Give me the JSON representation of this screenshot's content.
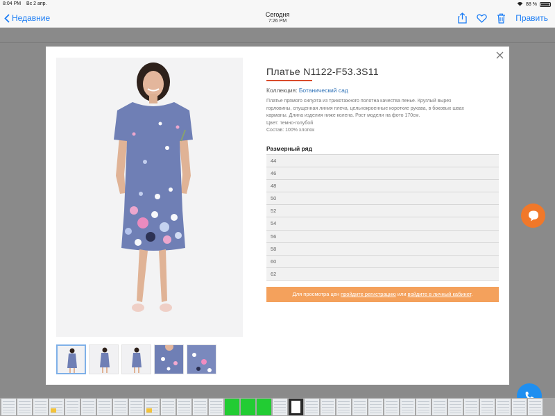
{
  "status_bar": {
    "time": "8:04 PM",
    "date": "Вс 2 апр.",
    "battery": "88 %"
  },
  "nav": {
    "back_label": "Недавние",
    "title": "Сегодня",
    "subtitle": "7:26 PM",
    "edit_label": "Править"
  },
  "product": {
    "title": "Платье N1122-F53.3S11",
    "collection_label": "Коллекция:",
    "collection_link": "Ботанический сад",
    "description": [
      "Платье прямого силуэта из трикотажного полотна качества пенье. Круглый вырез",
      "горловины, спущенная линия плеча, цельнокроенные короткие рукава, в боковых швах",
      "карманы. Длина изделия ниже колена. Рост модели на фото 170см.",
      "Цвет: темно-голубой",
      "Состав: 100% хлопок"
    ],
    "sizes_heading": "Размерный ряд",
    "sizes": [
      "44",
      "46",
      "48",
      "50",
      "52",
      "54",
      "56",
      "58",
      "60",
      "62"
    ],
    "banner": {
      "prefix": "Для просмотра цен ",
      "register_link": "пройдите регистрацию",
      "middle": " или ",
      "login_link": "войдите в личный кабинет",
      "suffix": "."
    }
  },
  "colors": {
    "accent_orange": "#f4a15c",
    "link_blue": "#2a6fb6",
    "ios_blue": "#1a7cf5",
    "title_underline": "#d94b2b"
  },
  "icons": [
    "chevron-left-icon",
    "share-icon",
    "heart-icon",
    "trash-icon",
    "close-icon",
    "chat-icon",
    "phone-icon",
    "wifi-icon",
    "battery-icon"
  ]
}
